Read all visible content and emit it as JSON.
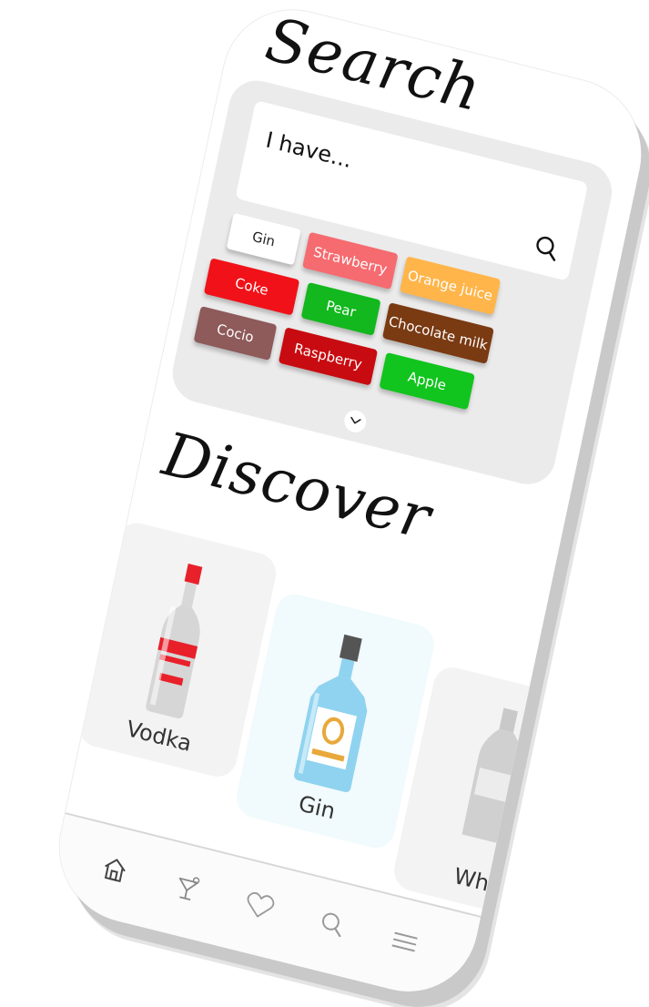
{
  "search": {
    "title": "Search",
    "placeholder": "I have...",
    "chips": [
      {
        "label": "Gin",
        "color": "#ffffff",
        "text_color": "#222222"
      },
      {
        "label": "Strawberry",
        "color": "#f56b70"
      },
      {
        "label": "Orange juice",
        "color": "#ffb54a"
      },
      {
        "label": "Coke",
        "color": "#f01218"
      },
      {
        "label": "Pear",
        "color": "#12b81d"
      },
      {
        "label": "Chocolate milk",
        "color": "#7a3a12"
      },
      {
        "label": "Cocio",
        "color": "#8e5a5a"
      },
      {
        "label": "Raspberry",
        "color": "#c80b10"
      },
      {
        "label": "Apple",
        "color": "#12c41e"
      }
    ]
  },
  "discover": {
    "title": "Discover",
    "cards": [
      {
        "label": "Vodka",
        "bottle_icon": "vodka-bottle-icon"
      },
      {
        "label": "Gin",
        "bottle_icon": "gin-bottle-icon"
      },
      {
        "label": "Whi",
        "bottle_icon": "whisky-bottle-icon"
      }
    ]
  },
  "nav": {
    "items": [
      {
        "icon": "home-icon"
      },
      {
        "icon": "cocktail-icon"
      },
      {
        "icon": "heart-icon"
      },
      {
        "icon": "search-icon"
      },
      {
        "icon": "menu-icon"
      }
    ]
  },
  "colors": {
    "panel": "#ebebeb",
    "accent_red": "#e8202a",
    "gin_blue": "#8fd3f0"
  }
}
